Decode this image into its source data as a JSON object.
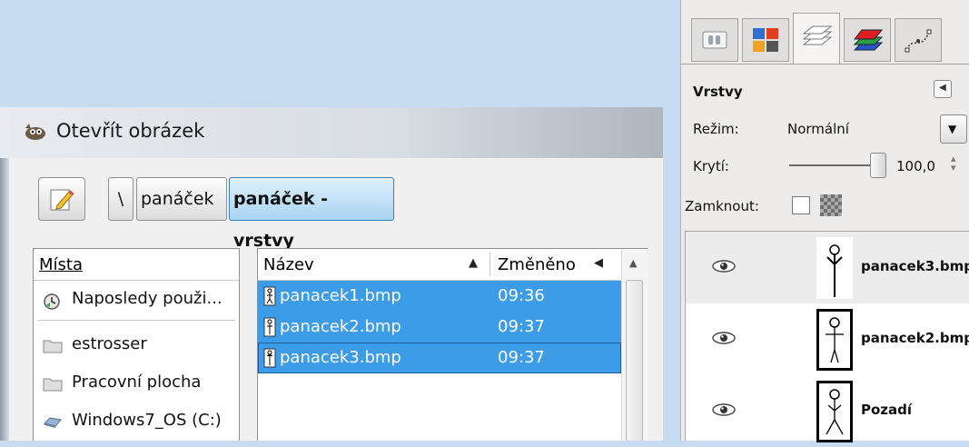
{
  "dialog": {
    "title": "Otevřít obrázek",
    "breadcrumb": {
      "root": "\\",
      "items": [
        "panáček",
        "panáček - vrstvy"
      ]
    },
    "places": {
      "header": "Místa",
      "items": [
        {
          "label": "Naposledy použi...",
          "icon": "recent-icon"
        },
        {
          "label": "estrosser",
          "icon": "folder-icon"
        },
        {
          "label": "Pracovní plocha",
          "icon": "folder-icon"
        },
        {
          "label": "Windows7_OS (C:)",
          "icon": "drive-icon"
        }
      ]
    },
    "files": {
      "columns": {
        "name": "Název",
        "modified": "Změněno",
        "sort_indicator": "▲",
        "more_indicator": "◀"
      },
      "rows": [
        {
          "name": "panacek1.bmp",
          "modified": "09:36",
          "selected": true
        },
        {
          "name": "panacek2.bmp",
          "modified": "09:37",
          "selected": true
        },
        {
          "name": "panacek3.bmp",
          "modified": "09:37",
          "selected": true
        }
      ]
    }
  },
  "layers_dock": {
    "tabs": [
      "tool-options-icon",
      "palette-icon",
      "layers-icon",
      "channels-icon",
      "paths-icon"
    ],
    "active_tab": "layers-icon",
    "title": "Vrstvy",
    "mode": {
      "label": "Režim:",
      "value": "Normální"
    },
    "opacity": {
      "label": "Krytí:",
      "value": "100,0",
      "percent": 100
    },
    "lock": {
      "label": "Zamknout:",
      "checked": false
    },
    "layers": [
      {
        "name": "panacek3.bmp",
        "visible": true,
        "active": true,
        "framed": false
      },
      {
        "name": "panacek2.bmp",
        "visible": true,
        "active": false,
        "framed": true
      },
      {
        "name": "Pozadí",
        "visible": true,
        "active": false,
        "framed": true
      }
    ]
  }
}
